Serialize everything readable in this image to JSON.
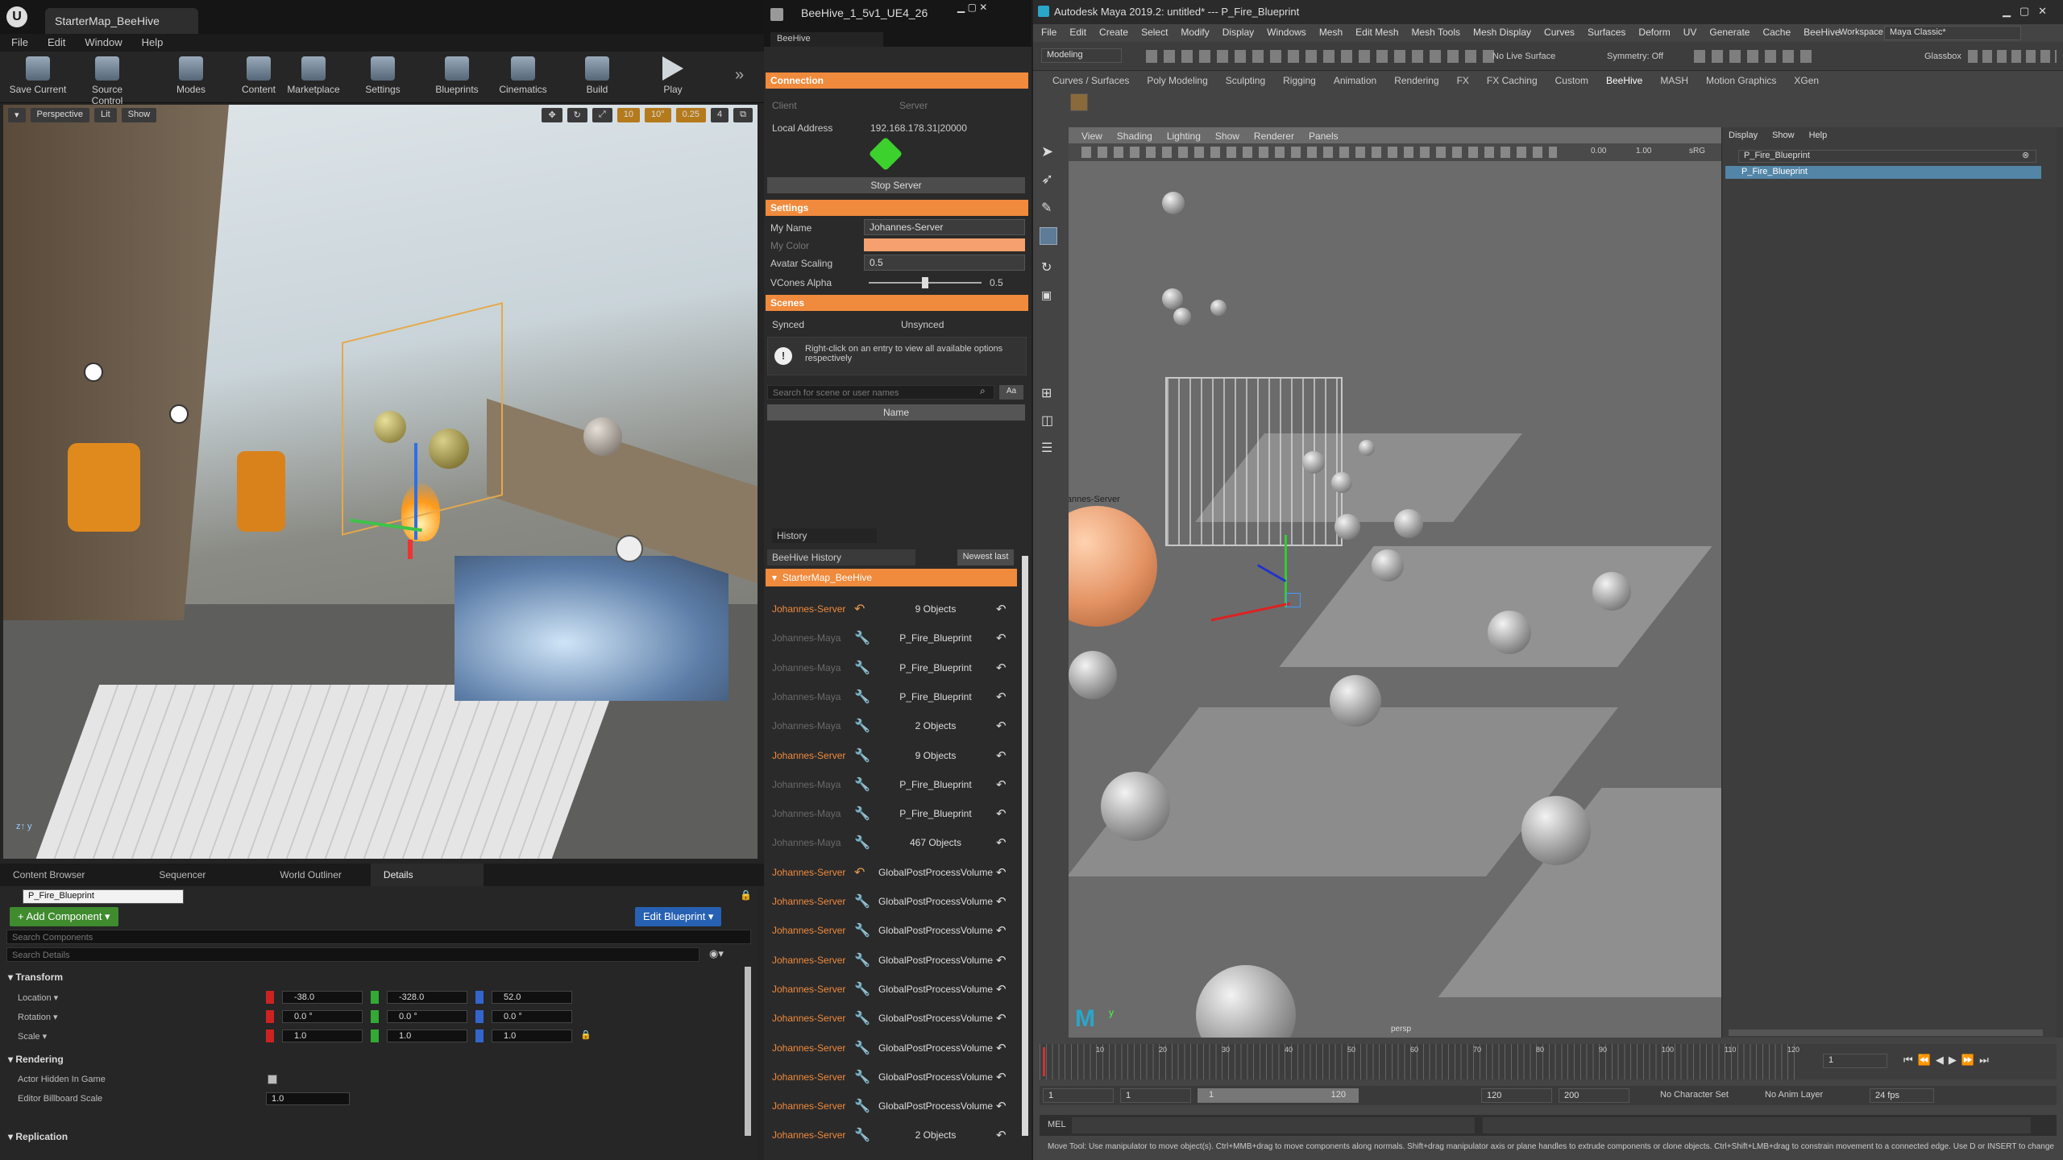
{
  "unreal": {
    "map_tab": "StarterMap_BeeHive",
    "menu": [
      "File",
      "Edit",
      "Window",
      "Help"
    ],
    "toolbar": [
      "Save Current",
      "Source Control",
      "Modes",
      "Content",
      "Marketplace",
      "Settings",
      "Blueprints",
      "Cinematics",
      "Build",
      "Play"
    ],
    "viewport": {
      "perspective": "Perspective",
      "lit": "Lit",
      "show": "Show",
      "grid_snap": "10",
      "rot_snap": "10°",
      "scale_snap": "0.25",
      "cam_speed": "4"
    },
    "panel_tabs": [
      "Content Browser",
      "Sequencer",
      "World Outliner",
      "Details"
    ],
    "details": {
      "name": "P_Fire_Blueprint",
      "add_component": "+ Add Component ▾",
      "edit_blueprint": "Edit Blueprint ▾",
      "search_components": "Search Components",
      "search_details": "Search Details",
      "transform_header": "Transform",
      "location_label": "Location ▾",
      "rotation_label": "Rotation ▾",
      "scale_label": "Scale ▾",
      "location": [
        "-38.0",
        "-328.0",
        "52.0"
      ],
      "rotation": [
        "0.0 °",
        "0.0 °",
        "0.0 °"
      ],
      "scale": [
        "1.0",
        "1.0",
        "1.0"
      ],
      "rendering_header": "Rendering",
      "actor_hidden": "Actor Hidden In Game",
      "billboard_scale": "Editor Billboard Scale",
      "billboard_value": "1.0",
      "replication_header": "Replication"
    }
  },
  "beehive": {
    "window_title": "BeeHive_1_5v1_UE4_26",
    "panel_tab": "BeeHive",
    "connection_header": "Connection",
    "client_label": "Client",
    "server_label": "Server",
    "local_address_label": "Local Address",
    "local_address": "192.168.178.31|20000",
    "stop_server": "Stop Server",
    "settings_header": "Settings",
    "my_name_label": "My Name",
    "my_name": "Johannes-Server",
    "my_color_label": "My Color",
    "my_color": "#f5a06e",
    "avatar_scaling_label": "Avatar Scaling",
    "avatar_scaling": "0.5",
    "vcones_alpha_label": "VCones Alpha",
    "vcones_alpha": "0.5",
    "scenes_header": "Scenes",
    "synced": "Synced",
    "unsynced": "Unsynced",
    "info": "Right-click on an entry to view all available options respectively",
    "search_placeholder": "Search for scene or user names",
    "aa": "Aa",
    "name_col": "Name",
    "history_tab": "History",
    "history_title": "BeeHive History",
    "newest_last": "Newest last",
    "scene": "StarterMap_BeeHive",
    "history": [
      {
        "user": "Johannes-Server",
        "obj": "9 Objects",
        "active": true,
        "icon": "undo"
      },
      {
        "user": "Johannes-Maya",
        "obj": "P_Fire_Blueprint",
        "active": false,
        "icon": "wrench"
      },
      {
        "user": "Johannes-Maya",
        "obj": "P_Fire_Blueprint",
        "active": false,
        "icon": "wrench"
      },
      {
        "user": "Johannes-Maya",
        "obj": "P_Fire_Blueprint",
        "active": false,
        "icon": "wrench"
      },
      {
        "user": "Johannes-Maya",
        "obj": "2 Objects",
        "active": false,
        "icon": "wrench"
      },
      {
        "user": "Johannes-Server",
        "obj": "9 Objects",
        "active": true,
        "icon": "wrench"
      },
      {
        "user": "Johannes-Maya",
        "obj": "P_Fire_Blueprint",
        "active": false,
        "icon": "wrench"
      },
      {
        "user": "Johannes-Maya",
        "obj": "P_Fire_Blueprint",
        "active": false,
        "icon": "wrench"
      },
      {
        "user": "Johannes-Maya",
        "obj": "467 Objects",
        "active": false,
        "icon": "wrench"
      },
      {
        "user": "Johannes-Server",
        "obj": "GlobalPostProcessVolume",
        "active": true,
        "icon": "undo"
      },
      {
        "user": "Johannes-Server",
        "obj": "GlobalPostProcessVolume",
        "active": true,
        "icon": "wrench"
      },
      {
        "user": "Johannes-Server",
        "obj": "GlobalPostProcessVolume",
        "active": true,
        "icon": "wrench"
      },
      {
        "user": "Johannes-Server",
        "obj": "GlobalPostProcessVolume",
        "active": true,
        "icon": "wrench"
      },
      {
        "user": "Johannes-Server",
        "obj": "GlobalPostProcessVolume",
        "active": true,
        "icon": "wrench"
      },
      {
        "user": "Johannes-Server",
        "obj": "GlobalPostProcessVolume",
        "active": true,
        "icon": "wrench"
      },
      {
        "user": "Johannes-Server",
        "obj": "GlobalPostProcessVolume",
        "active": true,
        "icon": "wrench"
      },
      {
        "user": "Johannes-Server",
        "obj": "GlobalPostProcessVolume",
        "active": true,
        "icon": "wrench"
      },
      {
        "user": "Johannes-Server",
        "obj": "GlobalPostProcessVolume",
        "active": true,
        "icon": "wrench"
      },
      {
        "user": "Johannes-Server",
        "obj": "2 Objects",
        "active": true,
        "icon": "wrench"
      }
    ]
  },
  "maya": {
    "window_title": "Autodesk Maya 2019.2: untitled*   ---   P_Fire_Blueprint",
    "menu": [
      "File",
      "Edit",
      "Create",
      "Select",
      "Modify",
      "Display",
      "Windows",
      "Mesh",
      "Edit Mesh",
      "Mesh Tools",
      "Mesh Display",
      "Curves",
      "Surfaces",
      "Deform",
      "UV",
      "Generate",
      "Cache",
      "BeeHive"
    ],
    "workspace_label": "Workspace :",
    "workspace": "Maya Classic*",
    "mode": "Modeling",
    "no_live_surface": "No Live Surface",
    "symmetry": "Symmetry: Off",
    "glassbox": "Glassbox",
    "shelf_tabs": [
      "Curves / Surfaces",
      "Poly Modeling",
      "Sculpting",
      "Rigging",
      "Animation",
      "Rendering",
      "FX",
      "FX Caching",
      "Custom",
      "BeeHive",
      "MASH",
      "Motion Graphics",
      "XGen"
    ],
    "vp_menu": [
      "View",
      "Shading",
      "Lighting",
      "Show",
      "Renderer",
      "Panels"
    ],
    "vp_label": "persp",
    "server_tag": "Johannes-Server",
    "exposure": "0.00",
    "gamma": "1.00",
    "srgb": "sRG",
    "outliner_menu": [
      "Display",
      "Show",
      "Help"
    ],
    "outliner_search": "P_Fire_Blueprint",
    "outliner_item": "P_Fire_Blueprint",
    "timeline_ticks": [
      "10",
      "20",
      "30",
      "40",
      "50",
      "60",
      "70",
      "80",
      "90",
      "100",
      "110",
      "120"
    ],
    "current_frame": "1",
    "range_start": "1",
    "range_inner_start": "1",
    "range_inner_value": "1",
    "range_inner_end": "120",
    "range_end": "120",
    "range_max": "200",
    "no_character": "No Character Set",
    "no_anim_layer": "No Anim Layer",
    "fps": "24 fps",
    "mel_label": "MEL",
    "help_line": "Move Tool: Use manipulator to move object(s). Ctrl+MMB+drag to move components along normals. Shift+drag manipulator axis or plane handles to extrude components or clone objects. Ctrl+Shift+LMB+drag to constrain movement to a connected edge. Use D or INSERT to change"
  }
}
